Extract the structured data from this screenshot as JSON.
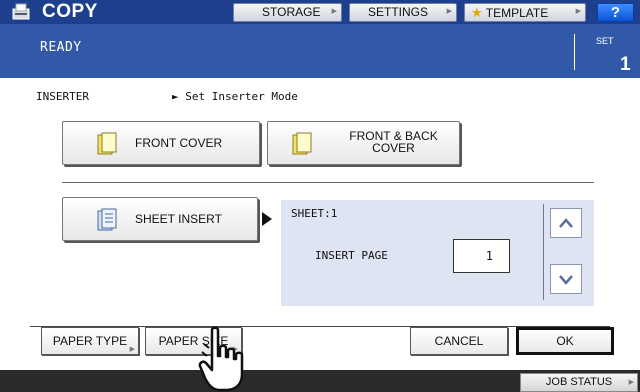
{
  "header": {
    "title": "COPY",
    "buttons": [
      {
        "label": "STORAGE"
      },
      {
        "label": "SETTINGS"
      },
      {
        "label": "TEMPLATE",
        "icon": "star-icon"
      }
    ],
    "help_label": "?"
  },
  "status": {
    "text": "READY",
    "set_label": "SET",
    "set_count": "1"
  },
  "section": {
    "title": "INSERTER",
    "mode": "► Set Inserter Mode"
  },
  "options": {
    "front_cover": "FRONT COVER",
    "front_back_cover_line1": "FRONT & BACK",
    "front_back_cover_line2": "COVER",
    "sheet_insert": "SHEET INSERT"
  },
  "panel": {
    "sheet_label": "SHEET:1",
    "insert_page_label": "INSERT PAGE",
    "insert_page_value": "1"
  },
  "footer": {
    "paper_type": "PAPER TYPE",
    "paper_size": "PAPER SIZE",
    "cancel": "CANCEL",
    "ok": "OK"
  },
  "job_status": "JOB STATUS",
  "colors": {
    "title_bar": "#1d3f8e",
    "status_bar": "#3259a8",
    "panel_bg": "#dfe4f2",
    "help_button": "#0a55d6"
  }
}
